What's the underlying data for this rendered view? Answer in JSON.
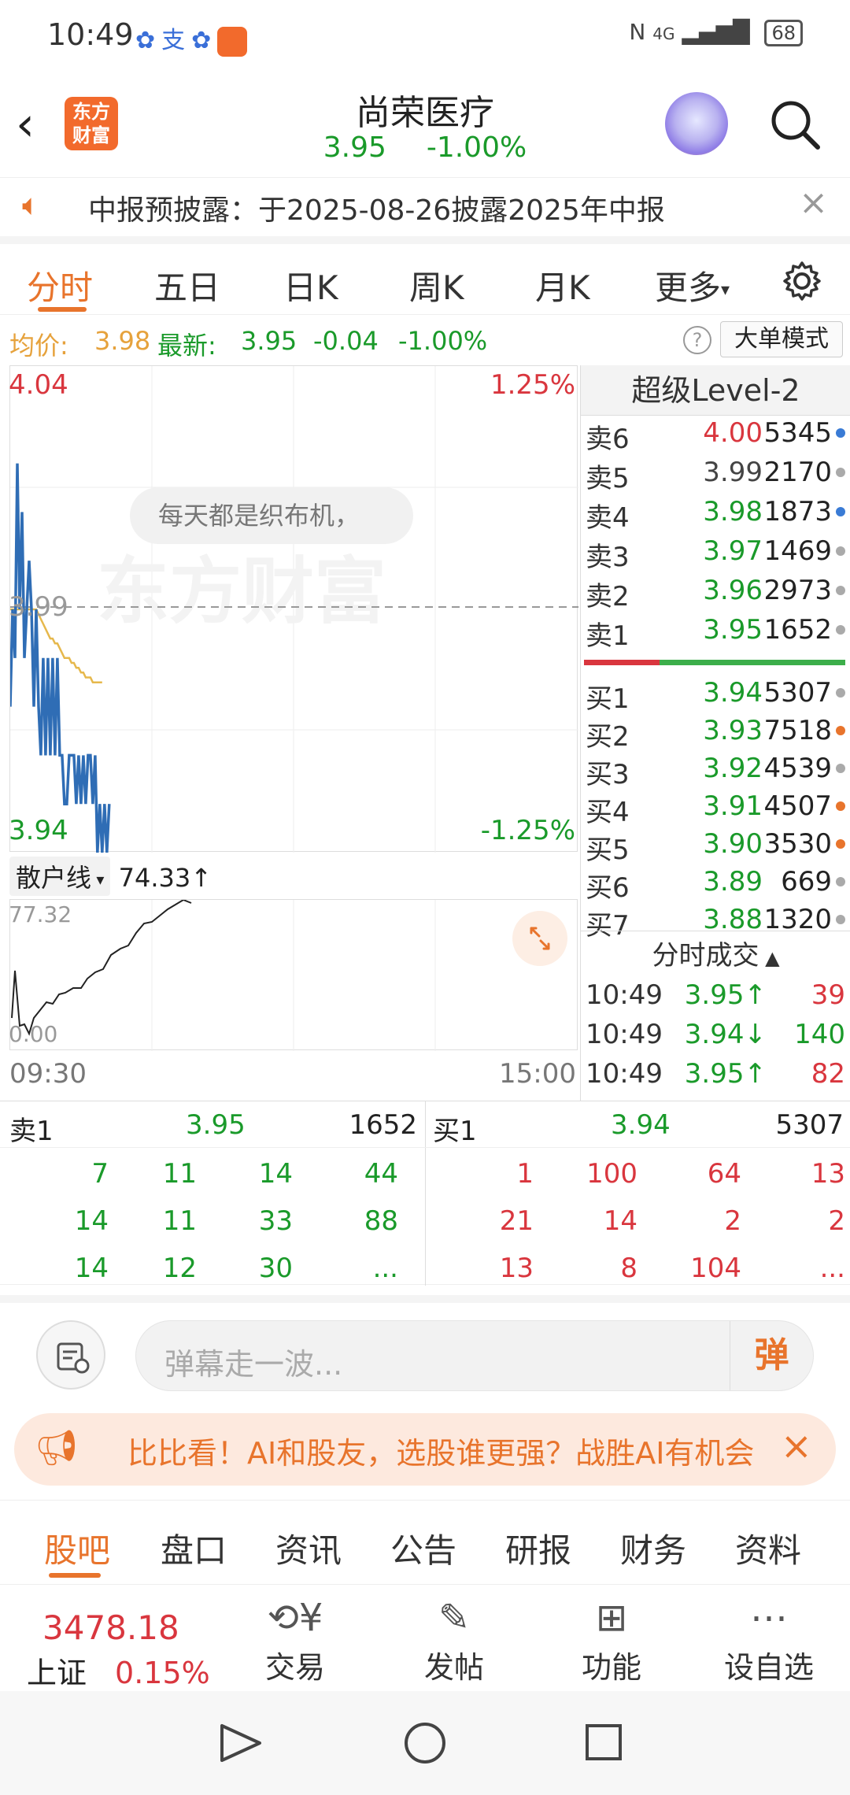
{
  "status_bar": {
    "time": "10:49",
    "battery": "68",
    "signal": "4G"
  },
  "header": {
    "stock_name": "尚荣医疗",
    "price": "3.95",
    "change_pct": "-1.00%",
    "logo_text": "东方财富"
  },
  "notice": {
    "text": "中报预披露：于2025-08-26披露2025年中报"
  },
  "chart_tabs": [
    "分时",
    "五日",
    "日K",
    "周K",
    "月K",
    "更多"
  ],
  "info": {
    "avg_label": "均价:",
    "avg_value": "3.98",
    "latest_label": "最新:",
    "latest_value": "3.95",
    "change": "-0.04",
    "change_pct": "-1.00%",
    "mode_button": "大单模式"
  },
  "chart_labels": {
    "high": "4.04",
    "high_pct": "1.25%",
    "mid": "3.99",
    "low": "3.94",
    "low_pct": "-1.25%",
    "bubble": "每天都是织布机，",
    "watermark": "东方财富"
  },
  "indicator": {
    "name": "散户线",
    "value": "74.33",
    "arrow": "↑",
    "top": "77.32",
    "bottom": "0.00",
    "time_start": "09:30",
    "time_end": "15:00"
  },
  "chart_data": {
    "type": "line",
    "ylim": [
      3.94,
      4.04
    ],
    "series": [
      {
        "values": [
          3.97,
          3.99,
          3.98,
          4.02,
          3.99,
          4.01,
          3.98,
          3.99,
          4.0,
          3.99,
          3.97,
          3.99,
          3.97,
          3.96,
          3.98,
          3.96,
          3.98,
          3.96,
          3.98,
          3.96,
          3.98,
          3.96,
          3.96,
          3.95,
          3.95,
          3.96,
          3.96,
          3.96,
          3.95,
          3.96,
          3.95,
          3.96,
          3.95,
          3.96,
          3.96,
          3.95,
          3.96,
          3.94,
          3.95,
          3.94,
          3.95,
          3.94,
          3.95
        ]
      },
      {
        "values": [
          3.99,
          3.99,
          3.99,
          3.99,
          3.99,
          3.99,
          3.99,
          3.99,
          3.99,
          3.99,
          3.99,
          3.99,
          3.989,
          3.988,
          3.987,
          3.986,
          3.985,
          3.984,
          3.984,
          3.983,
          3.983,
          3.982,
          3.981,
          3.98,
          3.98,
          3.98,
          3.979,
          3.979,
          3.978,
          3.978,
          3.977,
          3.977,
          3.976,
          3.976,
          3.976,
          3.975,
          3.975,
          3.975,
          3.975,
          3.975
        ]
      }
    ]
  },
  "level2": {
    "title": "超级Level-2",
    "asks": [
      {
        "label": "卖6",
        "price": "4.00",
        "vol": "5345",
        "dot": "#3a7bd5"
      },
      {
        "label": "卖5",
        "price": "3.99",
        "vol": "2170",
        "dot": "#aaaaaa"
      },
      {
        "label": "卖4",
        "price": "3.98",
        "vol": "1873",
        "dot": "#3a7bd5"
      },
      {
        "label": "卖3",
        "price": "3.97",
        "vol": "1469",
        "dot": "#aaaaaa"
      },
      {
        "label": "卖2",
        "price": "3.96",
        "vol": "2973",
        "dot": "#aaaaaa"
      },
      {
        "label": "卖1",
        "price": "3.95",
        "vol": "1652",
        "dot": "#aaaaaa"
      }
    ],
    "bids": [
      {
        "label": "买1",
        "price": "3.94",
        "vol": "5307",
        "dot": "#aaaaaa"
      },
      {
        "label": "买2",
        "price": "3.93",
        "vol": "7518",
        "dot": "#e8742c"
      },
      {
        "label": "买3",
        "price": "3.92",
        "vol": "4539",
        "dot": "#aaaaaa"
      },
      {
        "label": "买4",
        "price": "3.91",
        "vol": "4507",
        "dot": "#e8742c"
      },
      {
        "label": "买5",
        "price": "3.90",
        "vol": "3530",
        "dot": "#e8742c"
      },
      {
        "label": "买6",
        "price": "3.89",
        "vol": "669",
        "dot": "#aaaaaa"
      },
      {
        "label": "买7",
        "price": "3.88",
        "vol": "1320",
        "dot": "#aaaaaa"
      }
    ],
    "trades_title": "分时成交",
    "trades": [
      {
        "time": "10:49",
        "price": "3.95↑",
        "vol": "39"
      },
      {
        "time": "10:49",
        "price": "3.94↓",
        "vol": "140"
      },
      {
        "time": "10:49",
        "price": "3.95↑",
        "vol": "82"
      }
    ]
  },
  "queue": {
    "sell": {
      "label": "卖1",
      "price": "3.95",
      "vol": "1652",
      "cells": [
        [
          "7",
          "11",
          "14",
          "44"
        ],
        [
          "14",
          "11",
          "33",
          "88"
        ],
        [
          "14",
          "12",
          "30",
          "..."
        ]
      ]
    },
    "buy": {
      "label": "买1",
      "price": "3.94",
      "vol": "5307",
      "cells": [
        [
          "1",
          "100",
          "64",
          "13"
        ],
        [
          "21",
          "14",
          "2",
          "2"
        ],
        [
          "13",
          "8",
          "104",
          "..."
        ]
      ]
    }
  },
  "comment": {
    "placeholder": "弹幕走一波...",
    "danmu_btn": "弹"
  },
  "promo": {
    "text": "比比看！AI和股友，选股谁更强？战胜AI有机会"
  },
  "bottom_tabs": [
    "股吧",
    "盘口",
    "资讯",
    "公告",
    "研报",
    "财务",
    "资料"
  ],
  "dock": {
    "index_value": "3478.18",
    "index_name": "上证",
    "index_pct": "0.15%",
    "items": [
      "交易",
      "发帖",
      "功能",
      "设自选"
    ]
  }
}
